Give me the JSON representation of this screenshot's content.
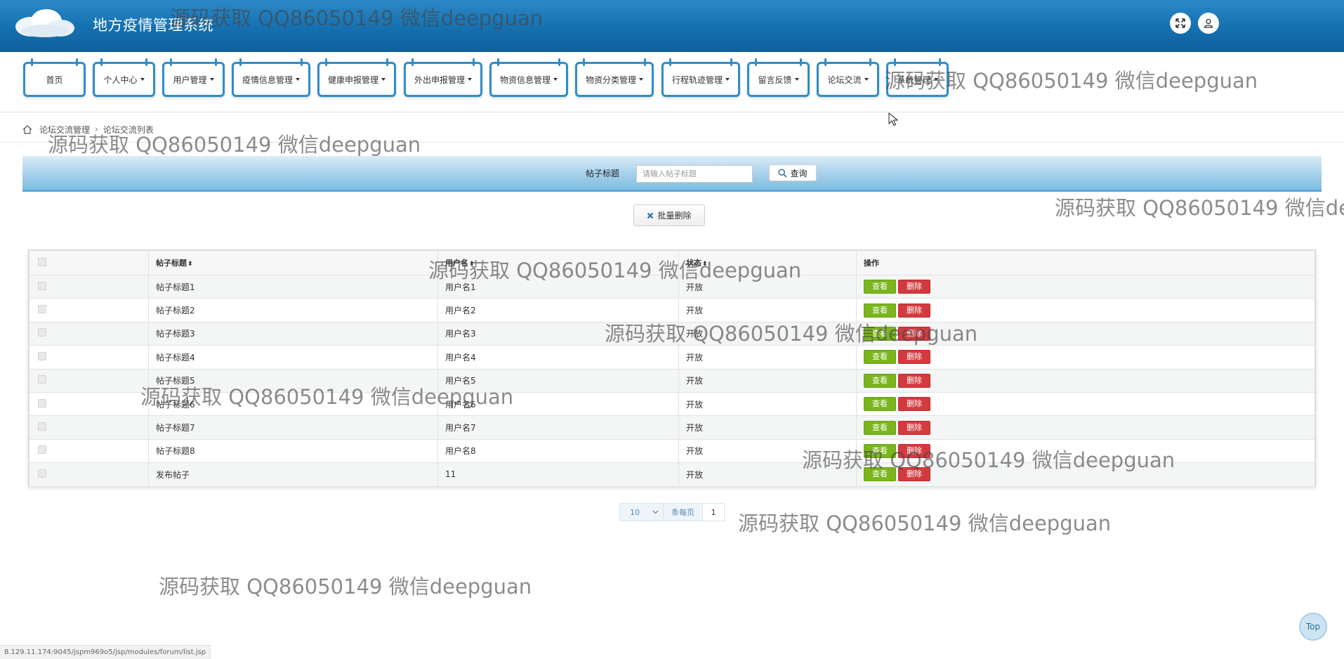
{
  "header": {
    "title": "地方疫情管理系统",
    "fullscreen_icon": "expand-icon",
    "user_icon": "user-icon"
  },
  "nav": {
    "items": [
      {
        "label": "首页",
        "dropdown": false
      },
      {
        "label": "个人中心",
        "dropdown": true
      },
      {
        "label": "用户管理",
        "dropdown": true
      },
      {
        "label": "疫情信息管理",
        "dropdown": true
      },
      {
        "label": "健康申报管理",
        "dropdown": true
      },
      {
        "label": "外出申报管理",
        "dropdown": true
      },
      {
        "label": "物资信息管理",
        "dropdown": true
      },
      {
        "label": "物资分类管理",
        "dropdown": true
      },
      {
        "label": "行程轨迹管理",
        "dropdown": true
      },
      {
        "label": "留言反馈",
        "dropdown": true
      },
      {
        "label": "论坛交流",
        "dropdown": true
      },
      {
        "label": "系统管理",
        "dropdown": true
      }
    ]
  },
  "breadcrumb": {
    "items": [
      "论坛交流管理",
      "论坛交流列表"
    ],
    "separator": "›"
  },
  "search": {
    "label": "帖子标题",
    "placeholder": "请输入帖子标题",
    "value": "",
    "button_label": "查询"
  },
  "actions": {
    "bulk_delete_label": "批量删除"
  },
  "table": {
    "columns": [
      "",
      "帖子标题",
      "用户名",
      "状态",
      "操作"
    ],
    "sort_symbol": "⬍",
    "view_label": "查看",
    "delete_label": "删除",
    "rows": [
      {
        "title": "帖子标题1",
        "username": "用户名1",
        "status": "开放"
      },
      {
        "title": "帖子标题2",
        "username": "用户名2",
        "status": "开放"
      },
      {
        "title": "帖子标题3",
        "username": "用户名3",
        "status": "开放"
      },
      {
        "title": "帖子标题4",
        "username": "用户名4",
        "status": "开放"
      },
      {
        "title": "帖子标题5",
        "username": "用户名5",
        "status": "开放"
      },
      {
        "title": "帖子标题6",
        "username": "用户名6",
        "status": "开放"
      },
      {
        "title": "帖子标题7",
        "username": "用户名7",
        "status": "开放"
      },
      {
        "title": "帖子标题8",
        "username": "用户名8",
        "status": "开放"
      },
      {
        "title": "发布帖子",
        "username": "11",
        "status": "开放"
      }
    ]
  },
  "pagination": {
    "page_size": "10",
    "per_page_label": "条每页",
    "current_page": "1"
  },
  "top_button": {
    "label": "Top"
  },
  "status_bar": {
    "url": "8.129.11.174:9045/jspm969o5/jsp/modules/forum/list.jsp"
  },
  "watermark": {
    "text": "源码获取 QQ86050149 微信deepguan"
  },
  "colors": {
    "header": "#1570b0",
    "nav_border": "#2d8ec9",
    "view_button": "#7ab51d",
    "delete_button": "#d33a3f"
  }
}
